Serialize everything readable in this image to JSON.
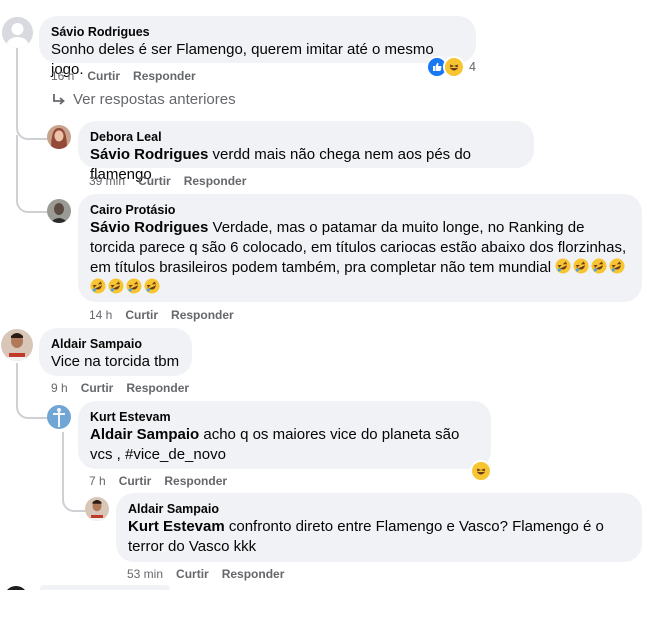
{
  "actions": {
    "like": "Curtir",
    "reply": "Responder"
  },
  "comments": [
    {
      "author": "Sávio Rodrigues",
      "mention": "",
      "text": "Sonho deles é ser Flamengo, querem imitar até o mesmo jogo.",
      "time": "16 h",
      "reaction_count": "4"
    },
    {
      "author": "Debora Leal",
      "mention": "Sávio Rodrigues",
      "text": " verdd mais não chega nem aos pés do flamengo",
      "time": "39 min"
    },
    {
      "author": "Cairo Protásio",
      "mention": "Sávio Rodrigues",
      "text": " Verdade, mas o patamar da muito longe, no Ranking de torcida parece q são 6 colocado, em títulos cariocas estão abaixo dos florzinhas, em títulos brasileiros podem também, pra completar não tem mundial",
      "time": "14 h"
    },
    {
      "author": "Aldair Sampaio",
      "mention": "",
      "text": "Vice na torcida tbm",
      "time": "9 h"
    },
    {
      "author": "Kurt Estevam",
      "mention": "Aldair Sampaio",
      "text": " acho q os maiores vice do planeta são vcs , #vice_de_novo",
      "time": "7 h"
    },
    {
      "author": "Aldair Sampaio",
      "mention": "Kurt Estevam",
      "text": " confronto direto entre Flamengo e Vasco? Flamengo é o terror do Vasco kkk",
      "time": "53 min"
    }
  ],
  "view_previous": "Ver respostas anteriores",
  "colors": {
    "bubble": "#f0f2f5",
    "meta": "#65676b",
    "like_blue": "#1877f2",
    "emoji_yellow": "#f7c531"
  }
}
